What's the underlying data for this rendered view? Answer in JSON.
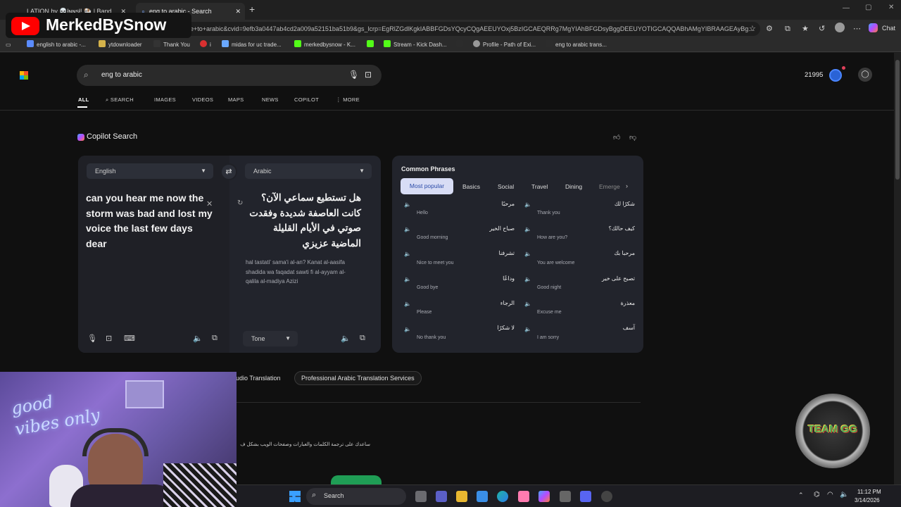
{
  "browser": {
    "tabs": [
      {
        "label": "LATION by 💀łɴɴѕł! 🐏 | Band"
      },
      {
        "label": "eng to arabic - Search"
      }
    ],
    "new_tab": "+",
    "url": "e+to+arabic&cvid=9efb3a0447ab4cd2a009a52151ba51b9&gs_lcrp=EgRlZGdlKgkIABBFGDsYQcyCQgAEEUYOxj5BzIGCAEQRRg7MgYIAhBFGDsyBggDEEUYOTIGCAQQABhAMgYIBRAAGEAyBg...",
    "chat_label": "Chat"
  },
  "bookmarks": [
    {
      "label": "english to arabic -..."
    },
    {
      "label": "ytdownloader"
    },
    {
      "label": "Thank You"
    },
    {
      "label": "i"
    },
    {
      "label": "midas for uc trade..."
    },
    {
      "label": "merkedbysnow - K..."
    },
    {
      "label": ""
    },
    {
      "label": "Stream - Kick Dash..."
    },
    {
      "label": ""
    },
    {
      "label": "Profile - Path of Exi..."
    },
    {
      "label": "eng to arabic trans..."
    }
  ],
  "search": {
    "query": "eng to arabic",
    "points": "21995"
  },
  "nav_tabs": [
    "ALL",
    "SEARCH",
    "IMAGES",
    "VIDEOS",
    "MAPS",
    "NEWS",
    "COPILOT",
    "MORE"
  ],
  "copilot": {
    "title": "Copilot Search"
  },
  "translator": {
    "source_lang": "English",
    "target_lang": "Arabic",
    "source_text": "can you hear me now the storm was bad and lost my voice the last few days dear",
    "target_text": "هل تستطيع سماعي الآن؟ كانت العاصفة شديدة وفقدت صوتي في الأيام القليلة الماضية عزيزي",
    "transliteration": "hal tastati' sama'i al-an? Kanat al-aasifa shadida wa faqadat sawti fi al-ayyam al-qalila al-madiya Azizi",
    "tone_label": "Tone"
  },
  "phrases": {
    "title": "Common Phrases",
    "tabs": [
      "Most popular",
      "Basics",
      "Social",
      "Travel",
      "Dining",
      "Emerge"
    ],
    "items": [
      {
        "ar": "مرحبًا",
        "en": "Hello"
      },
      {
        "ar": "شكرًا لك",
        "en": "Thank you"
      },
      {
        "ar": "صباح الخير",
        "en": "Good morning"
      },
      {
        "ar": "كيف حالك؟",
        "en": "How are you?"
      },
      {
        "ar": "تشرفنا",
        "en": "Nice to meet you"
      },
      {
        "ar": "مرحبا بك",
        "en": "You are welcome"
      },
      {
        "ar": "وداعًا",
        "en": "Good bye"
      },
      {
        "ar": "تصبح على خير",
        "en": "Good night"
      },
      {
        "ar": "الرجاء",
        "en": "Please"
      },
      {
        "ar": "معذرة",
        "en": "Excuse me"
      },
      {
        "ar": "لا شكرًا",
        "en": "No thank you"
      },
      {
        "ar": "آسف",
        "en": "I am sorry"
      }
    ]
  },
  "related": [
    "udio Translation",
    "Professional Arabic Translation Services"
  ],
  "arabic_snippet": "ساعدك على ترجمة الكلمات والعبارات وصفحات الويب بشكل ف",
  "taskbar": {
    "search_label": "Search",
    "time": "11:12 PM",
    "date": "3/14/2026"
  },
  "overlay": {
    "channel": "MerkedBySnow",
    "webcam_sign": "good vibes only",
    "logo_text": "TEAM GG"
  }
}
